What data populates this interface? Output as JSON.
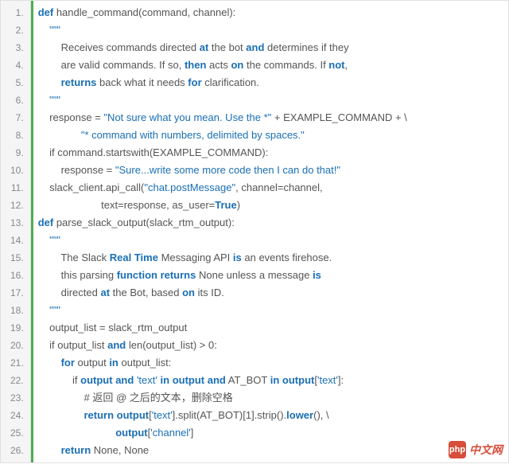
{
  "watermark": {
    "logo": "php",
    "text": "中文网"
  },
  "lines": [
    {
      "n": "1.",
      "ind": 0,
      "seg": [
        [
          "kw",
          "def "
        ],
        [
          "fn",
          "handle_command(command, channel):"
        ]
      ]
    },
    {
      "n": "2.",
      "ind": 1,
      "seg": [
        [
          "str",
          "\"\"\""
        ]
      ]
    },
    {
      "n": "3.",
      "ind": 2,
      "seg": [
        [
          "plain",
          "Receives commands directed "
        ],
        [
          "kw",
          "at"
        ],
        [
          "plain",
          " the bot "
        ],
        [
          "kw",
          "and"
        ],
        [
          "plain",
          " determines if they"
        ]
      ]
    },
    {
      "n": "4.",
      "ind": 2,
      "seg": [
        [
          "plain",
          "are valid commands. If so, "
        ],
        [
          "kw",
          "then"
        ],
        [
          "plain",
          " acts "
        ],
        [
          "kw",
          "on"
        ],
        [
          "plain",
          " the commands. If "
        ],
        [
          "kw",
          "not"
        ],
        [
          "plain",
          ","
        ]
      ]
    },
    {
      "n": "5.",
      "ind": 2,
      "seg": [
        [
          "kw",
          "returns"
        ],
        [
          "plain",
          " back what it needs "
        ],
        [
          "kw",
          "for"
        ],
        [
          "plain",
          " clarification."
        ]
      ]
    },
    {
      "n": "6.",
      "ind": 1,
      "seg": [
        [
          "str",
          "\"\"\""
        ]
      ]
    },
    {
      "n": "7.",
      "ind": 1,
      "seg": [
        [
          "plain",
          "response = "
        ],
        [
          "str",
          "\"Not sure what you mean. Use the *\""
        ],
        [
          "plain",
          " + EXAMPLE_COMMAND + \\"
        ]
      ]
    },
    {
      "n": "8.",
      "ind": 3,
      "seg": [
        [
          "plain",
          "   "
        ],
        [
          "str",
          "\"* command with numbers, delimited by spaces.\""
        ]
      ]
    },
    {
      "n": "9.",
      "ind": 1,
      "seg": [
        [
          "plain",
          "if command.startswith(EXAMPLE_COMMAND):"
        ]
      ]
    },
    {
      "n": "10.",
      "ind": 2,
      "seg": [
        [
          "plain",
          "response = "
        ],
        [
          "str",
          "\"Sure...write some more code then I can do that!\""
        ]
      ]
    },
    {
      "n": "11.",
      "ind": 1,
      "seg": [
        [
          "plain",
          "slack_client.api_call("
        ],
        [
          "str",
          "\"chat.postMessage\""
        ],
        [
          "plain",
          ", channel=channel,"
        ]
      ]
    },
    {
      "n": "12.",
      "ind": 5,
      "seg": [
        [
          "plain",
          "  text=response, as_user="
        ],
        [
          "builtin",
          "True"
        ],
        [
          "plain",
          ")"
        ]
      ]
    },
    {
      "n": "13.",
      "ind": 0,
      "seg": [
        [
          "kw",
          "def "
        ],
        [
          "fn",
          "parse_slack_output(slack_rtm_output):"
        ]
      ]
    },
    {
      "n": "14.",
      "ind": 1,
      "seg": [
        [
          "str",
          "\"\"\""
        ]
      ]
    },
    {
      "n": "15.",
      "ind": 2,
      "seg": [
        [
          "plain",
          "The Slack "
        ],
        [
          "kw",
          "Real Time"
        ],
        [
          "plain",
          " Messaging API "
        ],
        [
          "kw",
          "is"
        ],
        [
          "plain",
          " an events firehose."
        ]
      ]
    },
    {
      "n": "16.",
      "ind": 2,
      "seg": [
        [
          "plain",
          "this parsing "
        ],
        [
          "kw",
          "function returns"
        ],
        [
          "plain",
          " None unless a message "
        ],
        [
          "kw",
          "is"
        ]
      ]
    },
    {
      "n": "17.",
      "ind": 2,
      "seg": [
        [
          "plain",
          "directed "
        ],
        [
          "kw",
          "at"
        ],
        [
          "plain",
          " the Bot, based "
        ],
        [
          "kw",
          "on"
        ],
        [
          "plain",
          " its ID."
        ]
      ]
    },
    {
      "n": "18.",
      "ind": 1,
      "seg": [
        [
          "str",
          "\"\"\""
        ]
      ]
    },
    {
      "n": "19.",
      "ind": 1,
      "seg": [
        [
          "plain",
          "output_list = slack_rtm_output"
        ]
      ]
    },
    {
      "n": "20.",
      "ind": 1,
      "seg": [
        [
          "plain",
          "if output_list "
        ],
        [
          "kw",
          "and"
        ],
        [
          "plain",
          " len(output_list) > 0:"
        ]
      ]
    },
    {
      "n": "21.",
      "ind": 2,
      "seg": [
        [
          "kw",
          "for"
        ],
        [
          "plain",
          " output "
        ],
        [
          "kw",
          "in"
        ],
        [
          "plain",
          " output_list:"
        ]
      ]
    },
    {
      "n": "22.",
      "ind": 3,
      "seg": [
        [
          "plain",
          "if "
        ],
        [
          "kw",
          "output"
        ],
        [
          "plain",
          " "
        ],
        [
          "kw",
          "and"
        ],
        [
          "plain",
          " "
        ],
        [
          "str",
          "'text'"
        ],
        [
          "plain",
          " "
        ],
        [
          "kw",
          "in"
        ],
        [
          "plain",
          " "
        ],
        [
          "kw",
          "output"
        ],
        [
          "plain",
          " "
        ],
        [
          "kw",
          "and"
        ],
        [
          "plain",
          " AT_BOT "
        ],
        [
          "kw",
          "in"
        ],
        [
          "plain",
          " "
        ],
        [
          "kw",
          "output"
        ],
        [
          "plain",
          "["
        ],
        [
          "str",
          "'text'"
        ],
        [
          "plain",
          "]:"
        ]
      ]
    },
    {
      "n": "23.",
      "ind": 4,
      "seg": [
        [
          "plain",
          "# 返回 @ 之后的文本，删除空格"
        ]
      ]
    },
    {
      "n": "24.",
      "ind": 4,
      "seg": [
        [
          "kw",
          "return"
        ],
        [
          "plain",
          " "
        ],
        [
          "kw",
          "output"
        ],
        [
          "plain",
          "["
        ],
        [
          "str",
          "'text'"
        ],
        [
          "plain",
          "].split(AT_BOT)[1].strip()."
        ],
        [
          "kw",
          "lower"
        ],
        [
          "plain",
          "(), \\"
        ]
      ]
    },
    {
      "n": "25.",
      "ind": 6,
      "seg": [
        [
          "plain",
          "   "
        ],
        [
          "kw",
          "output"
        ],
        [
          "plain",
          "["
        ],
        [
          "str",
          "'channel'"
        ],
        [
          "plain",
          "]"
        ]
      ]
    },
    {
      "n": "26.",
      "ind": 2,
      "seg": [
        [
          "kw",
          "return"
        ],
        [
          "plain",
          " None, None"
        ]
      ]
    }
  ]
}
